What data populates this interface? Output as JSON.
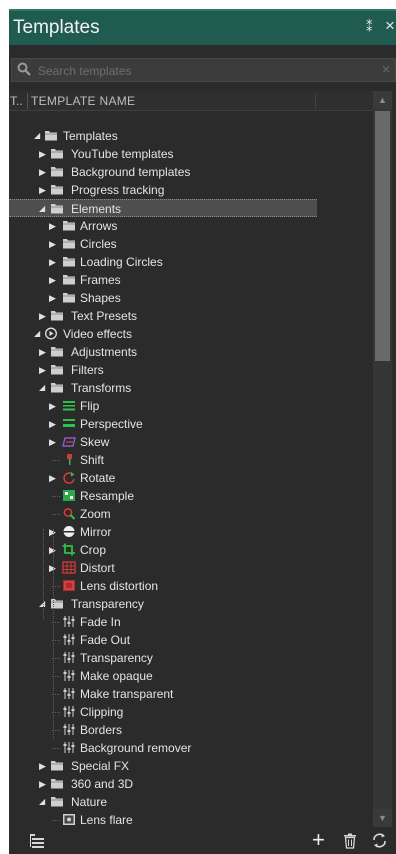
{
  "panel": {
    "title": "Templates",
    "pin_glyph": "⁑",
    "close_glyph": "×"
  },
  "search": {
    "placeholder": "Search templates",
    "clear_glyph": "×"
  },
  "columns": {
    "type_short": "T..",
    "name": "TEMPLATE NAME"
  },
  "tree": [
    {
      "label": "Templates",
      "depth": 0,
      "expander": "expanded",
      "icon": "folder-icon"
    },
    {
      "label": "YouTube templates",
      "depth": 1,
      "expander": "collapsed",
      "icon": "folder-icon"
    },
    {
      "label": "Background templates",
      "depth": 1,
      "expander": "collapsed",
      "icon": "folder-icon"
    },
    {
      "label": "Progress tracking",
      "depth": 1,
      "expander": "collapsed",
      "icon": "folder-icon"
    },
    {
      "label": "Elements",
      "depth": 1,
      "expander": "expanded",
      "icon": "folder-icon",
      "selected": true
    },
    {
      "label": "Arrows",
      "depth": 2,
      "expander": "collapsed",
      "icon": "folder-icon"
    },
    {
      "label": "Circles",
      "depth": 2,
      "expander": "collapsed",
      "icon": "folder-icon"
    },
    {
      "label": "Loading Circles",
      "depth": 2,
      "expander": "collapsed",
      "icon": "folder-icon"
    },
    {
      "label": "Frames",
      "depth": 2,
      "expander": "collapsed",
      "icon": "folder-icon"
    },
    {
      "label": "Shapes",
      "depth": 2,
      "expander": "collapsed",
      "icon": "folder-icon"
    },
    {
      "label": "Text Presets",
      "depth": 1,
      "expander": "collapsed",
      "icon": "folder-icon"
    },
    {
      "label": "Video effects",
      "depth": 0,
      "expander": "expanded",
      "icon": "play-circle-icon"
    },
    {
      "label": "Adjustments",
      "depth": 1,
      "expander": "collapsed",
      "icon": "folder-icon"
    },
    {
      "label": "Filters",
      "depth": 1,
      "expander": "collapsed",
      "icon": "folder-icon"
    },
    {
      "label": "Transforms",
      "depth": 1,
      "expander": "expanded",
      "icon": "folder-icon"
    },
    {
      "label": "Flip",
      "depth": 2,
      "expander": "collapsed",
      "icon": "flip-icon"
    },
    {
      "label": "Perspective",
      "depth": 2,
      "expander": "collapsed",
      "icon": "perspective-icon"
    },
    {
      "label": "Skew",
      "depth": 2,
      "expander": "collapsed",
      "icon": "skew-icon"
    },
    {
      "label": "Shift",
      "depth": 2,
      "expander": "none",
      "icon": "shift-icon"
    },
    {
      "label": "Rotate",
      "depth": 2,
      "expander": "collapsed",
      "icon": "rotate-icon"
    },
    {
      "label": "Resample",
      "depth": 2,
      "expander": "none",
      "icon": "resample-icon"
    },
    {
      "label": "Zoom",
      "depth": 2,
      "expander": "none",
      "icon": "zoom-icon"
    },
    {
      "label": "Mirror",
      "depth": 2,
      "expander": "collapsed",
      "icon": "mirror-icon"
    },
    {
      "label": "Crop",
      "depth": 2,
      "expander": "collapsed",
      "icon": "crop-icon"
    },
    {
      "label": "Distort",
      "depth": 2,
      "expander": "collapsed",
      "icon": "distort-icon"
    },
    {
      "label": "Lens distortion",
      "depth": 2,
      "expander": "none",
      "icon": "lens-distortion-icon"
    },
    {
      "label": "Transparency",
      "depth": 1,
      "expander": "expanded",
      "icon": "folder-icon"
    },
    {
      "label": "Fade In",
      "depth": 2,
      "expander": "none",
      "icon": "sliders-icon"
    },
    {
      "label": "Fade Out",
      "depth": 2,
      "expander": "none",
      "icon": "sliders-icon"
    },
    {
      "label": "Transparency",
      "depth": 2,
      "expander": "none",
      "icon": "sliders-icon"
    },
    {
      "label": "Make opaque",
      "depth": 2,
      "expander": "none",
      "icon": "sliders-icon"
    },
    {
      "label": "Make transparent",
      "depth": 2,
      "expander": "none",
      "icon": "sliders-icon"
    },
    {
      "label": "Clipping",
      "depth": 2,
      "expander": "none",
      "icon": "sliders-icon"
    },
    {
      "label": "Borders",
      "depth": 2,
      "expander": "none",
      "icon": "sliders-icon"
    },
    {
      "label": "Background remover",
      "depth": 2,
      "expander": "none",
      "icon": "sliders-icon"
    },
    {
      "label": "Special FX",
      "depth": 1,
      "expander": "collapsed",
      "icon": "folder-icon"
    },
    {
      "label": "360 and 3D",
      "depth": 1,
      "expander": "collapsed",
      "icon": "folder-icon"
    },
    {
      "label": "Nature",
      "depth": 1,
      "expander": "expanded",
      "icon": "folder-icon"
    },
    {
      "label": "Lens flare",
      "depth": 2,
      "expander": "none",
      "icon": "lens-flare-icon"
    }
  ],
  "toolbar": {
    "add_glyph": "+"
  },
  "colors": {
    "title_bar": "#1f5b4e",
    "panel_bg": "#2b2b2b",
    "selected_row": "#4e4e4e",
    "flip_green": "#2fbf4a",
    "red_accent": "#d23a3a",
    "purple_accent": "#8a5cc7"
  }
}
